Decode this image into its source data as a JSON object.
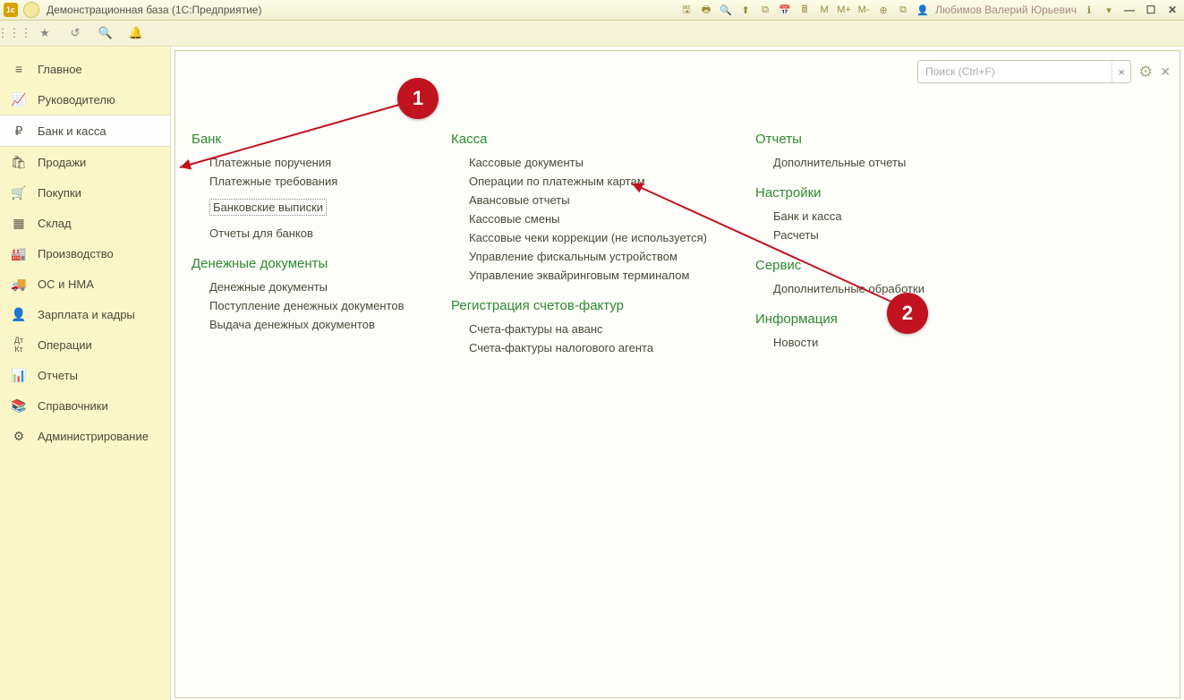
{
  "window": {
    "title": "Демонстрационная база  (1С:Предприятие)",
    "user": "Любимов Валерий Юрьевич",
    "mem_m": "M",
    "mem_mp": "M+",
    "mem_mm": "M-"
  },
  "search": {
    "placeholder": "Поиск (Ctrl+F)"
  },
  "sidebar": {
    "items": [
      {
        "label": "Главное",
        "icon": "≡"
      },
      {
        "label": "Руководителю",
        "icon": "↗"
      },
      {
        "label": "Банк и касса",
        "icon": "₽"
      },
      {
        "label": "Продажи",
        "icon": "🛍"
      },
      {
        "label": "Покупки",
        "icon": "🛒"
      },
      {
        "label": "Склад",
        "icon": "▦"
      },
      {
        "label": "Производство",
        "icon": "🏭"
      },
      {
        "label": "ОС и НМА",
        "icon": "🚚"
      },
      {
        "label": "Зарплата и кадры",
        "icon": "👤"
      },
      {
        "label": "Операции",
        "icon": "Дт/Кт"
      },
      {
        "label": "Отчеты",
        "icon": "📊"
      },
      {
        "label": "Справочники",
        "icon": "📚"
      },
      {
        "label": "Администрирование",
        "icon": "⚙"
      }
    ]
  },
  "groups": {
    "bank": {
      "title": "Банк",
      "items": [
        "Платежные поручения",
        "Платежные требования",
        "Банковские выписки",
        "Отчеты для банков"
      ]
    },
    "money_docs": {
      "title": "Денежные документы",
      "items": [
        "Денежные документы",
        "Поступление денежных документов",
        "Выдача денежных документов"
      ]
    },
    "kassa": {
      "title": "Касса",
      "items": [
        "Кассовые документы",
        "Операции по платежным картам",
        "Авансовые отчеты",
        "Кассовые смены",
        "Кассовые чеки коррекции (не используется)",
        "Управление фискальным устройством",
        "Управление эквайринговым терминалом"
      ]
    },
    "reg_sf": {
      "title": "Регистрация счетов-фактур",
      "items": [
        "Счета-фактуры на аванс",
        "Счета-фактуры налогового агента"
      ]
    },
    "reports": {
      "title": "Отчеты",
      "items": [
        "Дополнительные отчеты"
      ]
    },
    "settings": {
      "title": "Настройки",
      "items": [
        "Банк и касса",
        "Расчеты"
      ]
    },
    "service": {
      "title": "Сервис",
      "items": [
        "Дополнительные обработки"
      ]
    },
    "info": {
      "title": "Информация",
      "items": [
        "Новости"
      ]
    }
  },
  "badges": {
    "b1": "1",
    "b2": "2"
  }
}
